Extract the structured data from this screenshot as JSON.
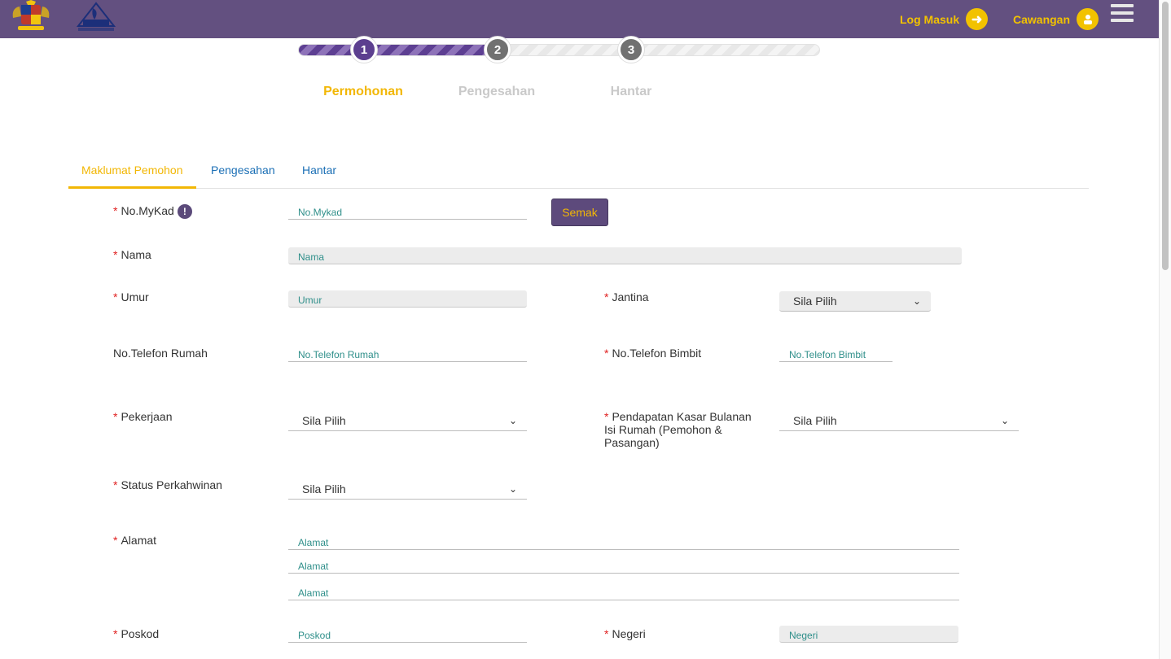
{
  "header": {
    "login_label": "Log Masuk",
    "branch_label": "Cawangan",
    "logo1_icon": "malaysia-coat-of-arms-icon",
    "logo2_icon": "lhdn-logo-icon",
    "menu_icon": "hamburger-menu-icon",
    "accent": "#f2c200",
    "bar_color": "#635080"
  },
  "progress": {
    "fraction": 0.38,
    "steps": [
      {
        "number": "1",
        "label": "Permohonan",
        "state": "active"
      },
      {
        "number": "2",
        "label": "Pengesahan",
        "state": "inactive"
      },
      {
        "number": "3",
        "label": "Hantar",
        "state": "inactive"
      }
    ]
  },
  "tabs": [
    {
      "label": "Maklumat Pemohon",
      "active": true
    },
    {
      "label": "Pengesahan",
      "active": false
    },
    {
      "label": "Hantar",
      "active": false
    }
  ],
  "form": {
    "mykad": {
      "label": "No.MyKad",
      "placeholder": "No.Mykad",
      "info_icon": "!"
    },
    "semak_label": "Semak",
    "nama": {
      "label": "Nama",
      "placeholder": "Nama"
    },
    "umur": {
      "label": "Umur",
      "placeholder": "Umur"
    },
    "jantina": {
      "label": "Jantina",
      "value": "Sila Pilih"
    },
    "tel_rumah": {
      "label": "No.Telefon Rumah",
      "placeholder": "No.Telefon Rumah"
    },
    "tel_bimbit": {
      "label": "No.Telefon Bimbit",
      "placeholder": "No.Telefon Bimbit"
    },
    "pekerjaan": {
      "label": "Pekerjaan",
      "value": "Sila Pilih"
    },
    "pendapatan": {
      "label": "Pendapatan Kasar Bulanan Isi Rumah (Pemohon & Pasangan)",
      "value": "Sila Pilih"
    },
    "status": {
      "label": "Status Perkahwinan",
      "value": "Sila Pilih"
    },
    "alamat": {
      "label": "Alamat",
      "placeholders": [
        "Alamat",
        "Alamat",
        "Alamat"
      ]
    },
    "poskod": {
      "label": "Poskod",
      "placeholder": "Poskod"
    },
    "negeri": {
      "label": "Negeri",
      "placeholder": "Negeri"
    }
  }
}
